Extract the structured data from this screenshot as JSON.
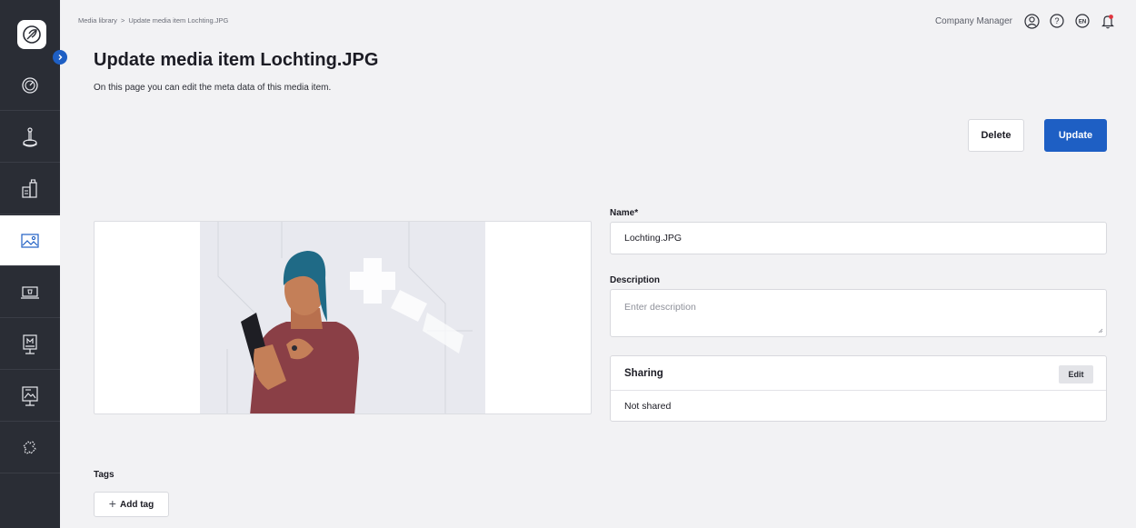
{
  "breadcrumb": {
    "parent": "Media library",
    "separator": ">",
    "current": "Update media item Lochting.JPG"
  },
  "header": {
    "user_name": "Company Manager",
    "language": "EN"
  },
  "page": {
    "title": "Update media item Lochting.JPG",
    "subtitle": "On this page you can edit the meta data of this media item."
  },
  "actions": {
    "delete_label": "Delete",
    "update_label": "Update"
  },
  "form": {
    "name_label": "Name*",
    "name_value": "Lochting.JPG",
    "description_label": "Description",
    "description_placeholder": "Enter description"
  },
  "sharing": {
    "title": "Sharing",
    "edit_label": "Edit",
    "status": "Not shared"
  },
  "tags": {
    "label": "Tags",
    "add_label": "Add tag"
  },
  "sidebar": {
    "items": [
      {
        "icon": "dashboard-icon"
      },
      {
        "icon": "joystick-icon"
      },
      {
        "icon": "products-icon"
      },
      {
        "icon": "media-library-icon",
        "active": true
      },
      {
        "icon": "screen-icon"
      },
      {
        "icon": "kiosk-icon"
      },
      {
        "icon": "presentation-icon"
      },
      {
        "icon": "puzzle-icon"
      }
    ]
  },
  "colors": {
    "accent": "#1e5fc4",
    "sidebar": "#2a2d35",
    "background": "#f2f2f4",
    "notification": "#e0333d"
  }
}
